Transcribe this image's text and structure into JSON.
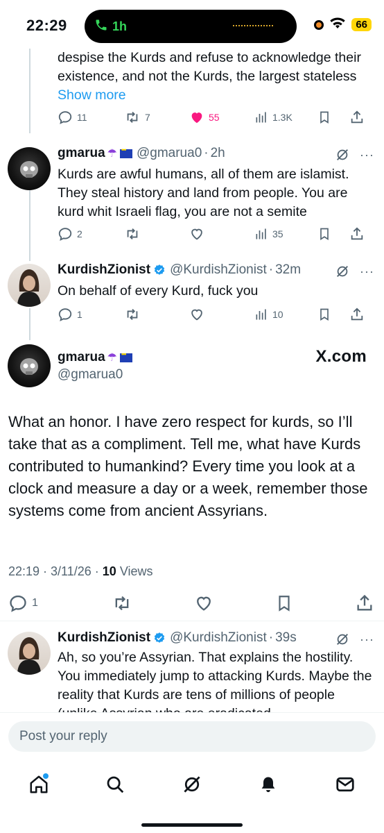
{
  "status_bar": {
    "time": "22:29",
    "call_duration": "1h",
    "battery": "66"
  },
  "thread": [
    {
      "body_partial": "despise the Kurds and refuse to acknowledge their existence, and not the Kurds, the largest stateless",
      "show_more": "Show more",
      "actions": {
        "replies": "11",
        "reposts": "7",
        "likes": "55",
        "views": "1.3K"
      }
    },
    {
      "name": "gmarua",
      "handle": "@gmarua0",
      "time": "2h",
      "body": "Kurds are awful humans, all of them are islamist. They steal history and land from people. You are kurd whit Israeli flag, you are not a semite",
      "actions": {
        "replies": "2",
        "reposts": "",
        "likes": "",
        "views": "35"
      }
    },
    {
      "name": "KurdishZionist",
      "handle": "@KurdishZionist",
      "time": "32m",
      "body": "On behalf of every Kurd, fuck you",
      "actions": {
        "replies": "1",
        "reposts": "",
        "likes": "",
        "views": "10"
      }
    }
  ],
  "main_post": {
    "name": "gmarua",
    "handle": "@gmarua0",
    "source": "X.com",
    "body": "What an honor. I have zero respect for kurds, so I’ll take that as a compliment. Tell me, what have Kurds contributed to humankind? Every time you look at a clock and measure a day or a week, remember those systems come from ancient Assyrians.",
    "timestamp": "22:19 · 3/11/26 ·",
    "views_count": "10",
    "views_label": "Views",
    "replies": "1"
  },
  "reply_post": {
    "name": "KurdishZionist",
    "handle": "@KurdishZionist",
    "time": "39s",
    "body": "Ah, so you’re Assyrian. That explains the hostility. You immediately jump to attacking Kurds. Maybe the reality that Kurds are tens of millions of people (unlike Assyrian who are eradicated"
  },
  "composer": {
    "placeholder": "Post your reply"
  },
  "nav": {
    "items": [
      "home-icon",
      "search-icon",
      "grok-icon",
      "notifications-icon",
      "messages-icon"
    ]
  },
  "colors": {
    "accent": "#1d9bf0",
    "like": "#f91880",
    "secondary_text": "#536471",
    "call_green": "#35d65a"
  }
}
